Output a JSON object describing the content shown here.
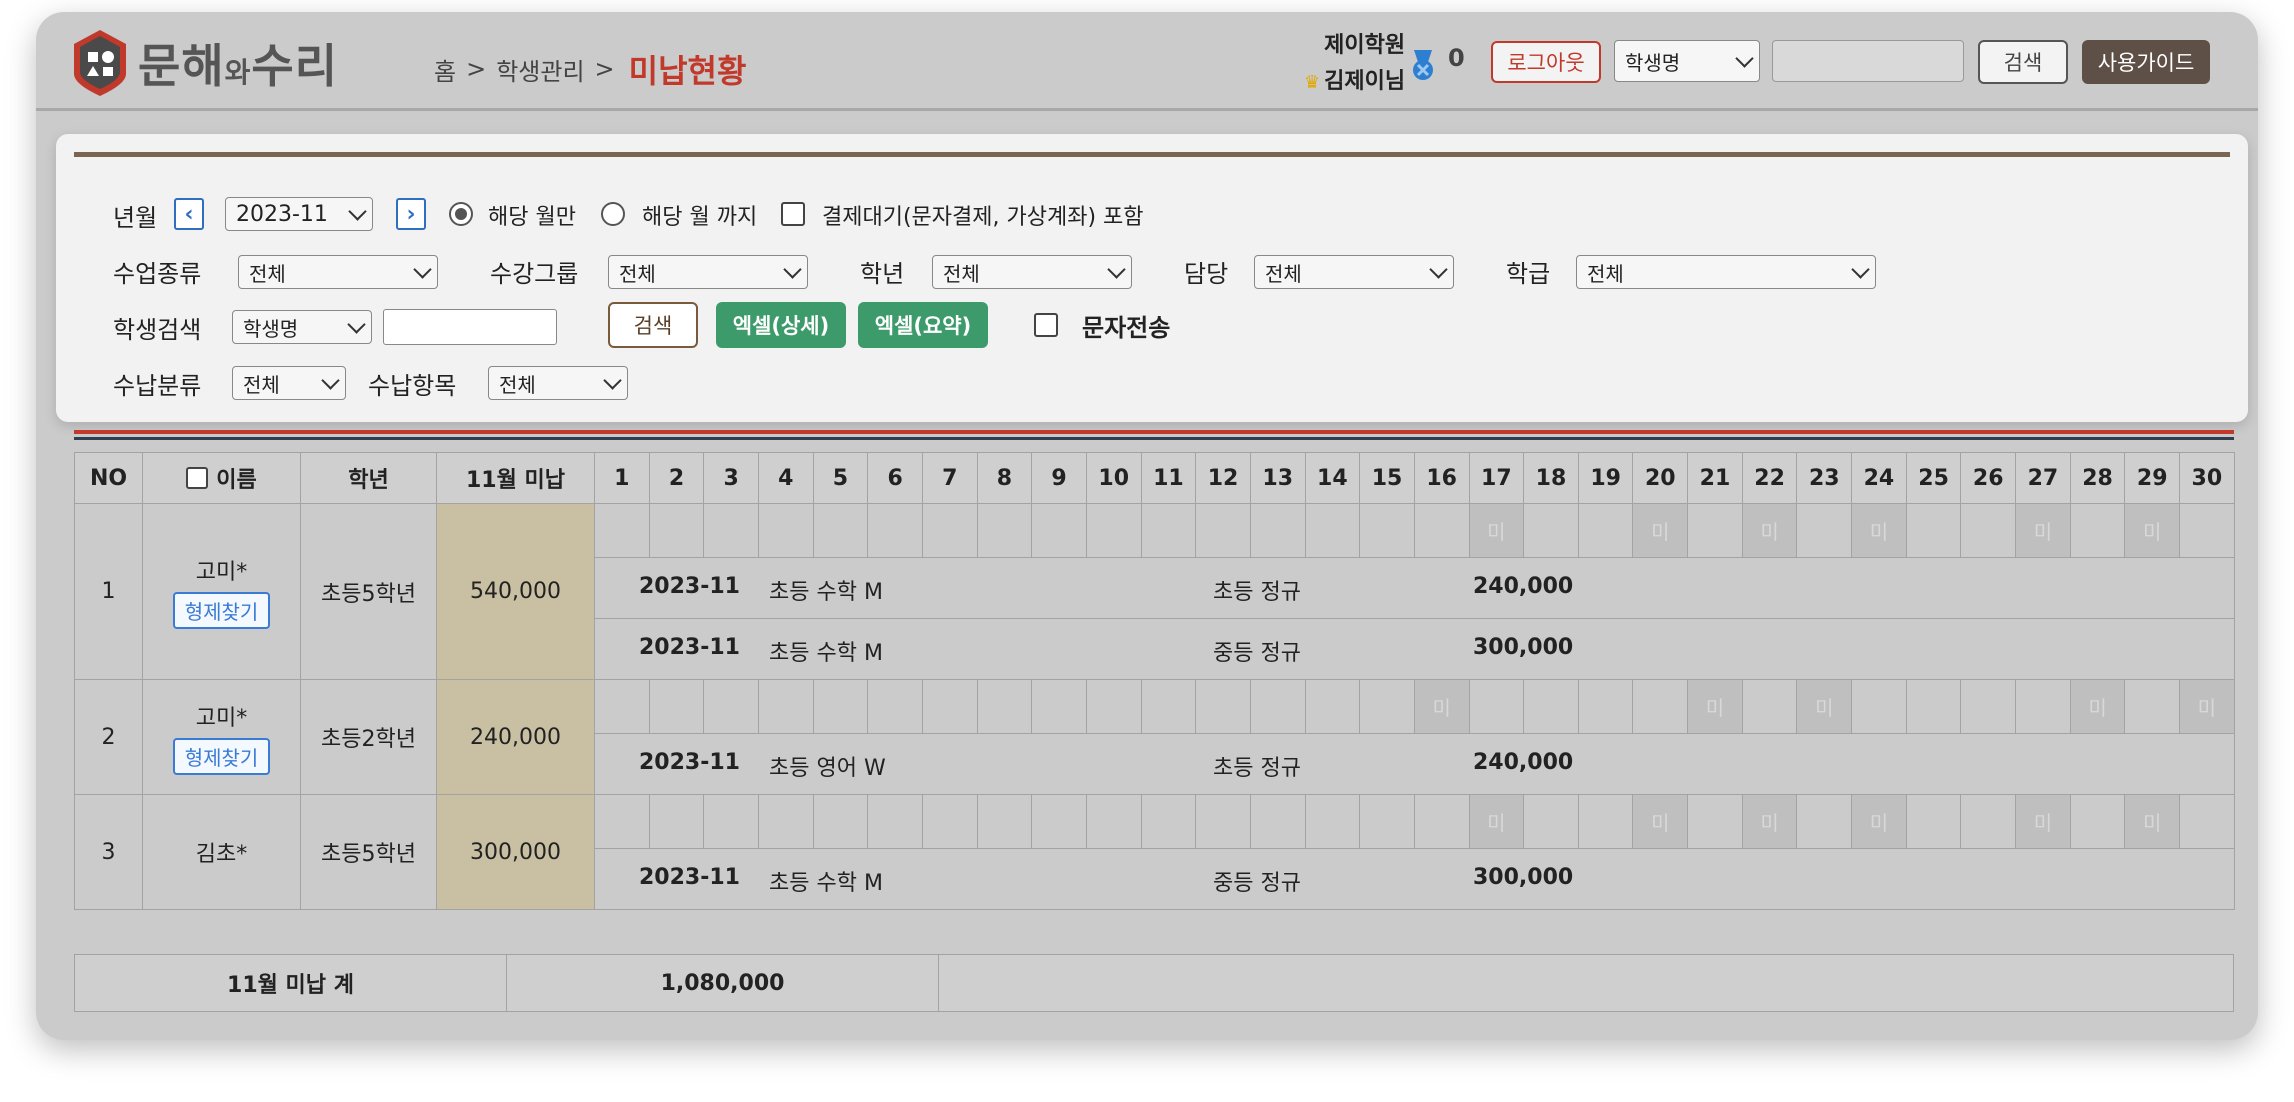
{
  "header": {
    "logo_main": "문해",
    "logo_wa": "와",
    "logo_sub": "수리",
    "breadcrumb": [
      "홈",
      ">",
      "학생관리",
      ">"
    ],
    "current_page": "미납현황",
    "academy_name": "제이학원",
    "user_name": "김제이님",
    "coin_count": "0",
    "logout_label": "로그아웃",
    "search_select": "학생명",
    "search_placeholder": "",
    "search_label": "검색",
    "guide_label": "사용가이드"
  },
  "filters": {
    "year_month_label": "년월",
    "year_month_value": "2023-11",
    "radio_month_only": "해당 월만",
    "radio_until_month": "해당 월 까지",
    "pending_label": "결제대기(문자결제, 가상계좌) 포함",
    "class_type_label": "수업종류",
    "class_type_value": "전체",
    "group_label": "수강그룹",
    "group_value": "전체",
    "grade_label": "학년",
    "grade_value": "전체",
    "manager_label": "담당",
    "manager_value": "전체",
    "class_label": "학급",
    "class_value": "전체",
    "student_search_label": "학생검색",
    "student_search_select": "학생명",
    "search_btn": "검색",
    "excel_detail_btn": "엑셀(상세)",
    "excel_summary_btn": "엑셀(요약)",
    "sms_label": "문자전송",
    "payment_cat_label": "수납분류",
    "payment_cat_value": "전체",
    "payment_item_label": "수납항목",
    "payment_item_value": "전체"
  },
  "table": {
    "headers": {
      "no": "NO",
      "name": "이름",
      "grade": "학년",
      "unpaid": "11월 미납"
    },
    "days": [
      "1",
      "2",
      "3",
      "4",
      "5",
      "6",
      "7",
      "8",
      "9",
      "10",
      "11",
      "12",
      "13",
      "14",
      "15",
      "16",
      "17",
      "18",
      "19",
      "20",
      "21",
      "22",
      "23",
      "24",
      "25",
      "26",
      "27",
      "28",
      "29",
      "30"
    ],
    "mark": "미",
    "sibling_label": "형제찾기",
    "rows": [
      {
        "no": "1",
        "name": "고미*",
        "sibling": true,
        "grade": "초등5학년",
        "unpaid": "540,000",
        "marked_days": [
          17,
          20,
          22,
          24,
          27,
          29
        ],
        "details": [
          {
            "ym": "2023-11",
            "course": "초등 수학 M",
            "type": "초등 정규",
            "amount": "240,000"
          },
          {
            "ym": "2023-11",
            "course": "초등 수학 M",
            "type": "중등 정규",
            "amount": "300,000"
          }
        ]
      },
      {
        "no": "2",
        "name": "고미*",
        "sibling": true,
        "grade": "초등2학년",
        "unpaid": "240,000",
        "marked_days": [
          16,
          21,
          23,
          28,
          30
        ],
        "details": [
          {
            "ym": "2023-11",
            "course": "초등 영어 W",
            "type": "초등 정규",
            "amount": "240,000"
          }
        ]
      },
      {
        "no": "3",
        "name": "김초*",
        "sibling": false,
        "grade": "초등5학년",
        "unpaid": "300,000",
        "marked_days": [
          17,
          20,
          22,
          24,
          27,
          29
        ],
        "details": [
          {
            "ym": "2023-11",
            "course": "초등 수학 M",
            "type": "중등 정규",
            "amount": "300,000"
          }
        ]
      }
    ]
  },
  "summary": {
    "label": "11월 미납 계",
    "total": "1,080,000"
  },
  "colors": {
    "accent_red": "#c0392b",
    "brand_brown": "#5e5046",
    "excel_green": "#3d9a6a",
    "unpaid_bg": "#c9c0a3"
  }
}
